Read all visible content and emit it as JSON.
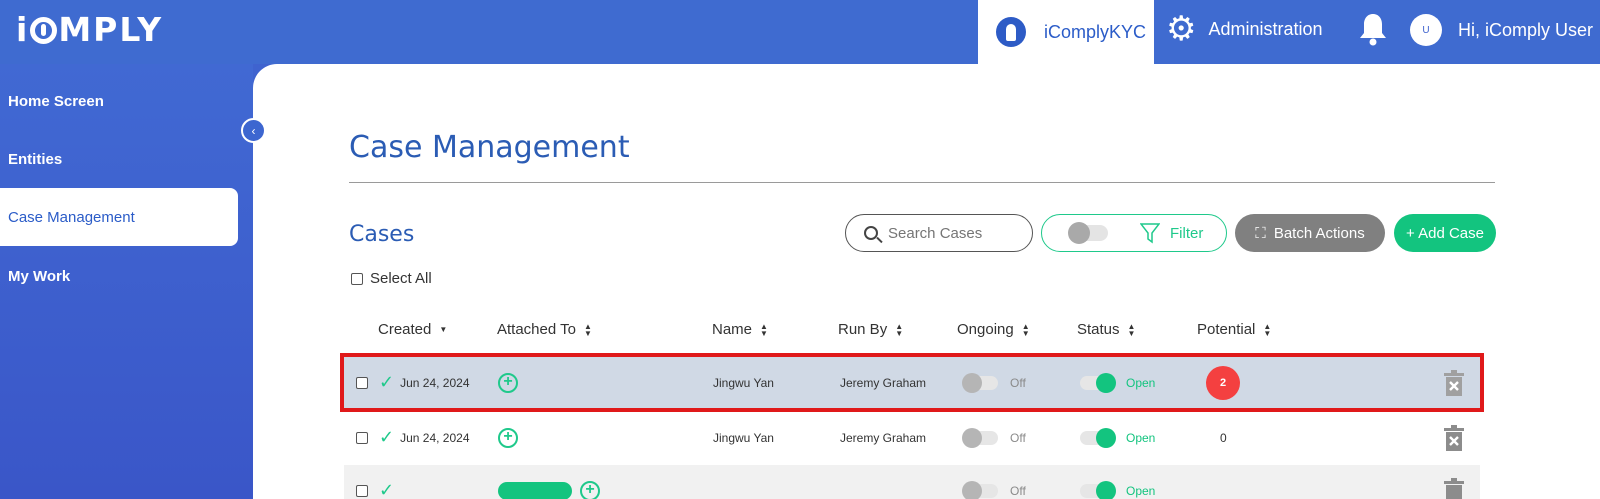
{
  "header": {
    "logo": "iCOMPLY",
    "app_tab": "iComplyKYC",
    "admin_label": "Administration",
    "avatar_initial": "U",
    "greeting": "Hi, iComply User"
  },
  "sidebar": {
    "items": [
      {
        "label": "Home Screen"
      },
      {
        "label": "Entities"
      },
      {
        "label": "Case Management"
      },
      {
        "label": "My Work"
      }
    ]
  },
  "main": {
    "page_title": "Case Management",
    "section_title": "Cases",
    "search_placeholder": "Search Cases",
    "filter_label": "Filter",
    "batch_label": "Batch Actions",
    "add_label": "+ Add Case",
    "select_all": "Select All",
    "columns": [
      "Created",
      "Attached To",
      "Name",
      "Run By",
      "Ongoing",
      "Status",
      "Potential"
    ],
    "rows": [
      {
        "created": "Jun 24, 2024",
        "name": "Jingwu Yan",
        "run_by": "Jeremy Graham",
        "ongoing": "Off",
        "status": "Open",
        "potential": "2"
      },
      {
        "created": "Jun 24, 2024",
        "name": "Jingwu Yan",
        "run_by": "Jeremy Graham",
        "ongoing": "Off",
        "status": "Open",
        "potential": "0"
      },
      {
        "created": "",
        "name": "",
        "run_by": "",
        "ongoing": "Off",
        "status": "Open",
        "potential": ""
      }
    ]
  },
  "colors": {
    "brand_blue": "#3f6bd0",
    "accent_green": "#13c47f",
    "alert_red": "#f44040"
  }
}
